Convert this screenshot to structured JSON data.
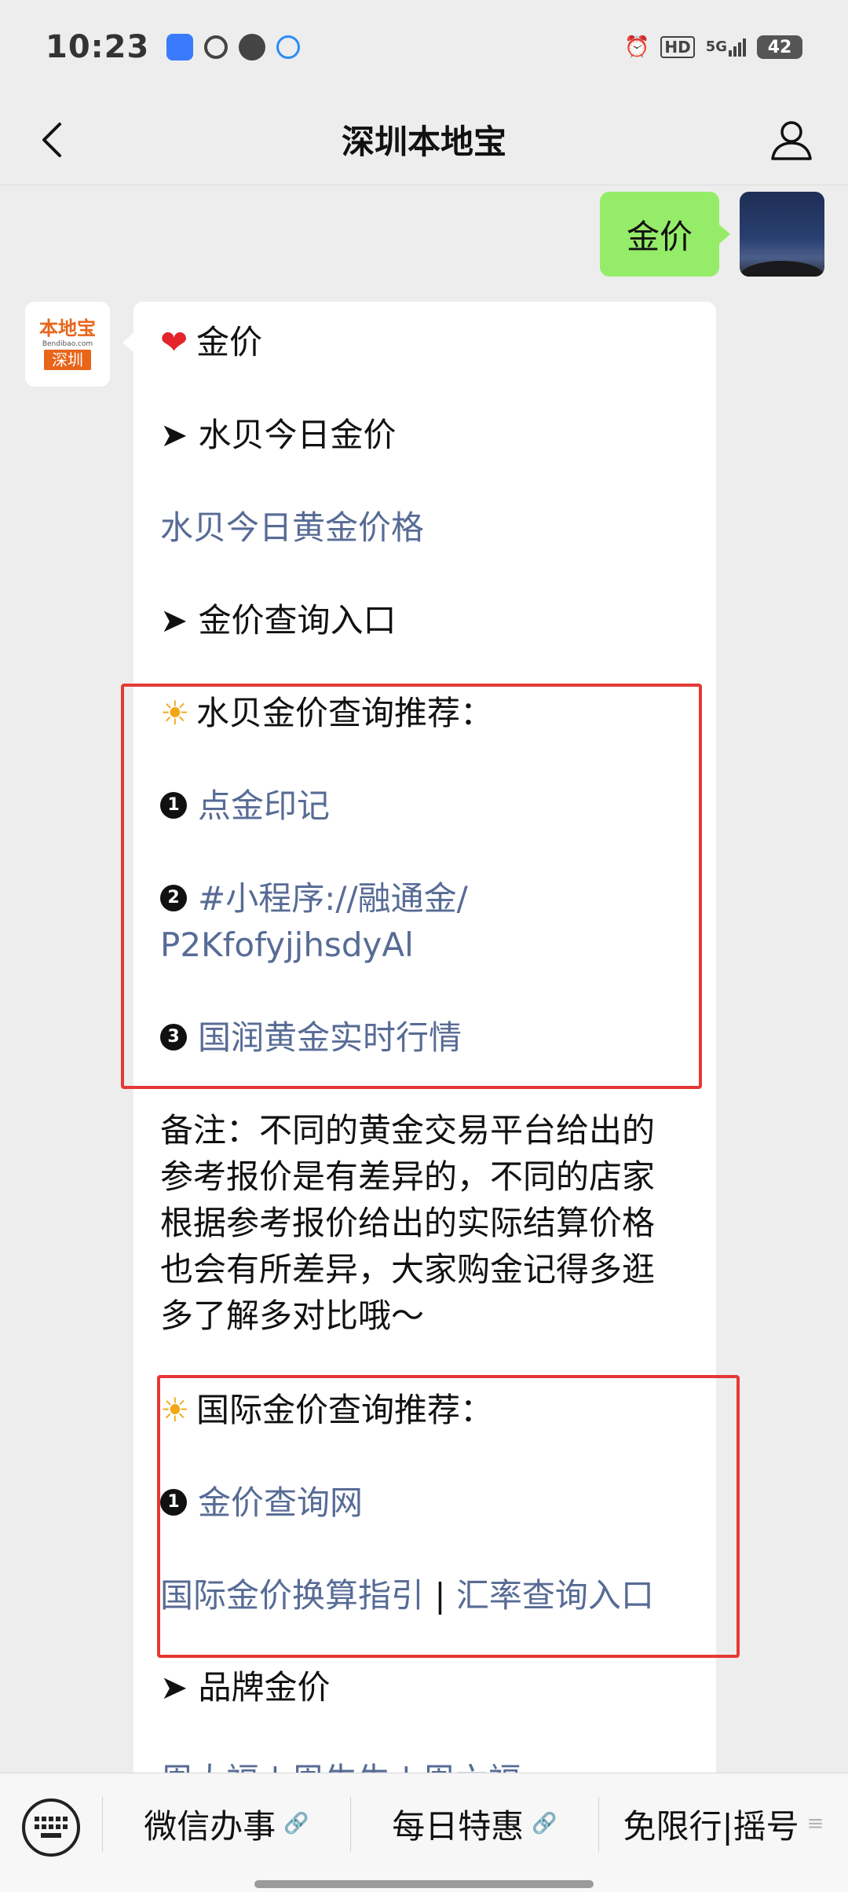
{
  "status_bar": {
    "time": "10:23",
    "network": "5G",
    "hd": "HD",
    "battery": "42"
  },
  "header": {
    "title": "深圳本地宝"
  },
  "sent_message": {
    "text": "金价"
  },
  "bot_avatar": {
    "brand": "本地宝",
    "site": "Bendibao.com",
    "city": "深圳"
  },
  "reply": {
    "heading": "金价",
    "section1": "➤ 水贝今日金价",
    "link_shuibei_price": "水贝今日黄金价格",
    "section2": "➤ 金价查询入口",
    "shuibei_recommend": "水贝金价查询推荐：",
    "num1": "1",
    "num2": "2",
    "num3": "3",
    "link_dianjin": "点金印记",
    "link_rongtong_1": "#小程序://融通金/",
    "link_rongtong_2": "P2KfofyjjhsdyAl",
    "link_guorun": "国润黄金实时行情",
    "note_lines": [
      "备注：不同的黄金交易平台给出的",
      "参考报价是有差异的，不同的店家",
      "根据参考报价给出的实际结算价格",
      "也会有所差异，大家购金记得多逛",
      "多了解多对比哦～"
    ],
    "intl_recommend": "国际金价查询推荐：",
    "link_jinjia_query": "金价查询网",
    "link_intl_convert": "国际金价换算指引",
    "separator": " | ",
    "link_exchange": "汇率查询入口",
    "section3": "➤ 品牌金价",
    "partial_next": "周大福 | 周生生 | 周六福"
  },
  "bottom_menu": {
    "items": [
      {
        "label": "微信办事"
      },
      {
        "label": "每日特惠"
      },
      {
        "label": "免限行|摇号"
      }
    ]
  }
}
